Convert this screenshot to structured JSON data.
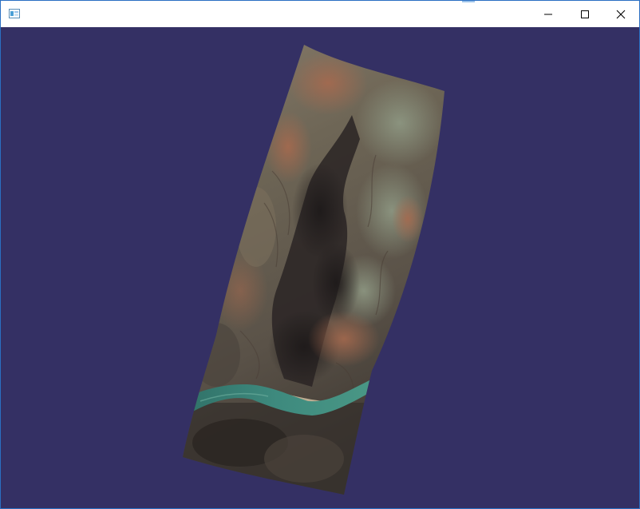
{
  "window": {
    "title": "",
    "icon": "app-window-icon",
    "controls": {
      "minimize": "minimize-icon",
      "maximize": "maximize-icon",
      "close": "close-icon"
    }
  },
  "scene": {
    "background_color": "#343064",
    "terrain_texture": "canyon-satellite-terrain",
    "river_color": "#3e8a7e"
  }
}
